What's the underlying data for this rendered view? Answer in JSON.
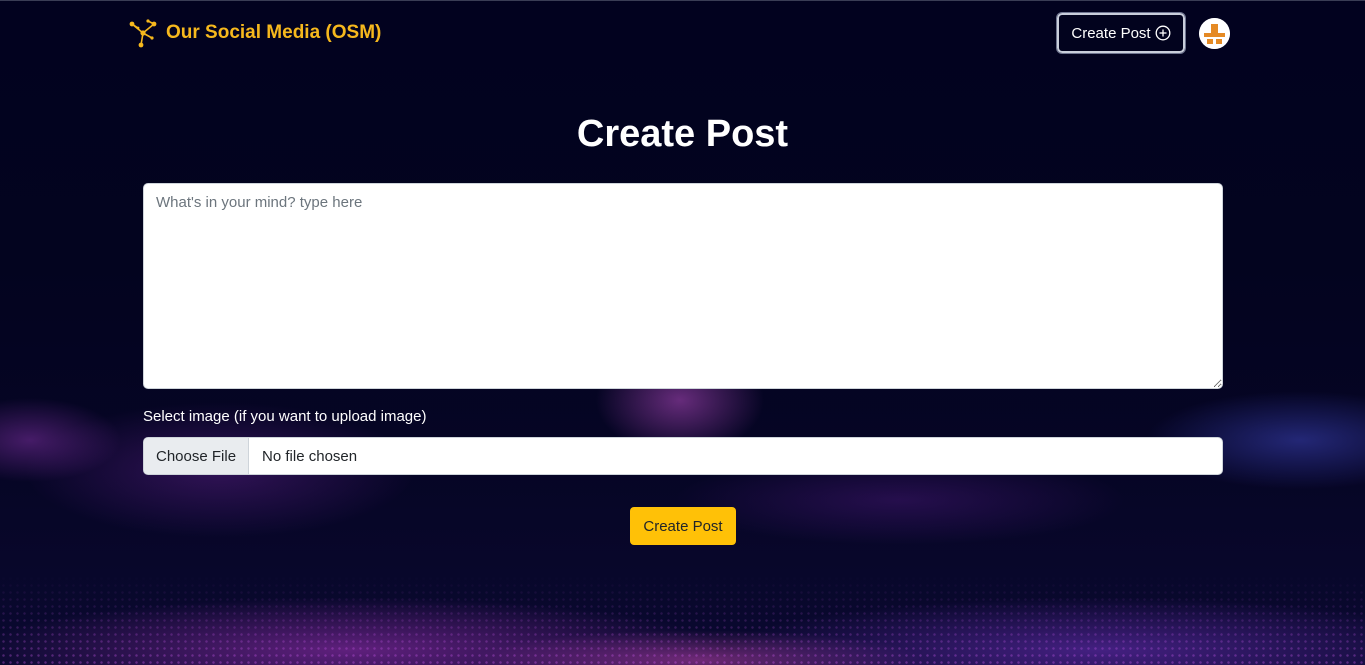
{
  "navbar": {
    "brand_title": "Our Social Media (OSM)",
    "brand_icon": "network-nodes-icon",
    "create_post_label": "Create Post",
    "create_post_icon": "plus-circle-icon",
    "avatar_icon": "user-avatar-icon"
  },
  "main": {
    "title": "Create Post",
    "post_placeholder": "What's in your mind? type here",
    "post_value": "",
    "image_label": "Select image (if you want to upload image)",
    "choose_file_label": "Choose File",
    "no_file_text": "No file chosen",
    "submit_label": "Create Post"
  },
  "colors": {
    "brand": "#f6b81d",
    "background": "#02031e",
    "submit_button": "#ffc107",
    "text_light": "#ffffff"
  }
}
